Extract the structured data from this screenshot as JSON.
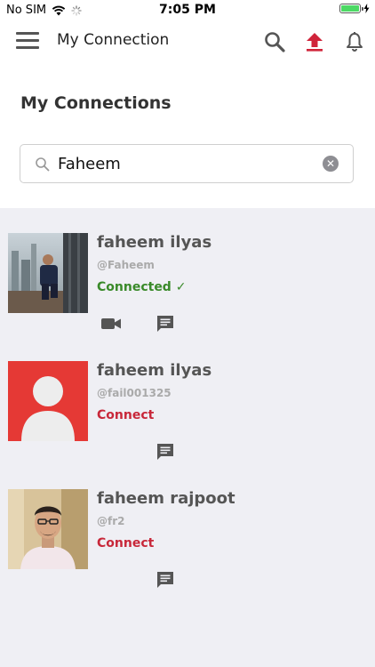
{
  "status_bar": {
    "carrier": "No SIM",
    "time": "7:05 PM"
  },
  "header": {
    "title": "My Connection"
  },
  "page": {
    "heading": "My Connections"
  },
  "search": {
    "value": "Faheem",
    "placeholder": ""
  },
  "connections": [
    {
      "name": "faheem ilyas",
      "handle": "@Faheem",
      "status": "Connected ✓",
      "status_type": "connected"
    },
    {
      "name": "faheem ilyas",
      "handle": "@fail001325",
      "status": "Connect",
      "status_type": "connect"
    },
    {
      "name": "faheem rajpoot",
      "handle": "@fr2",
      "status": "Connect",
      "status_type": "connect"
    }
  ],
  "colors": {
    "accent_red": "#c8283a",
    "connected_green": "#3a8a2a",
    "list_background": "#efeff4"
  },
  "icons": {
    "menu": "hamburger-icon",
    "search": "search-icon",
    "upload": "upload-icon",
    "notifications": "bell-icon",
    "video": "video-camera-icon",
    "message": "chat-icon"
  }
}
